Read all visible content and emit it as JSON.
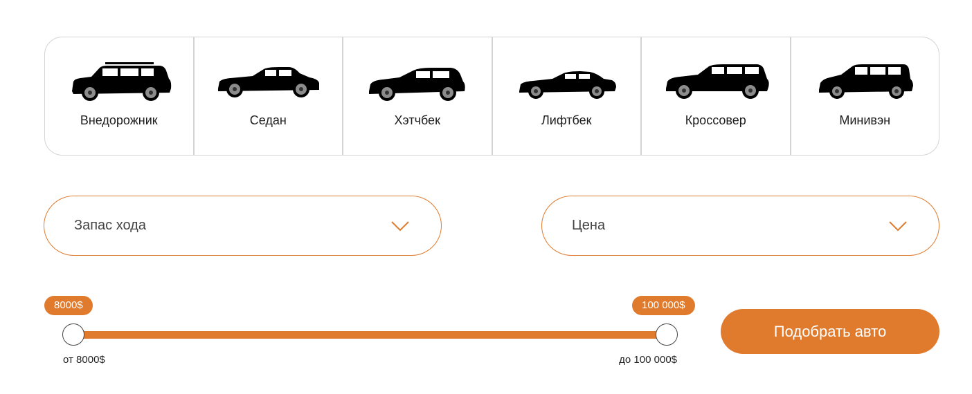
{
  "body_types": [
    {
      "label": "Внедорожник",
      "icon": "suv-icon"
    },
    {
      "label": "Седан",
      "icon": "sedan-icon"
    },
    {
      "label": "Хэтчбек",
      "icon": "hatchback-icon"
    },
    {
      "label": "Лифтбек",
      "icon": "liftback-icon"
    },
    {
      "label": "Кроссовер",
      "icon": "crossover-icon"
    },
    {
      "label": "Минивэн",
      "icon": "minivan-icon"
    }
  ],
  "filters": {
    "range_label": "Запас хода",
    "price_label": "Цена"
  },
  "price_slider": {
    "min_value": 8000,
    "max_value": 100000,
    "min_bubble": "8000$",
    "max_bubble": "100 000$",
    "min_caption": "от 8000$",
    "max_caption": "до 100 000$"
  },
  "submit_label": "Подобрать авто",
  "colors": {
    "accent": "#e07b2e",
    "border": "#d4d4d4"
  }
}
